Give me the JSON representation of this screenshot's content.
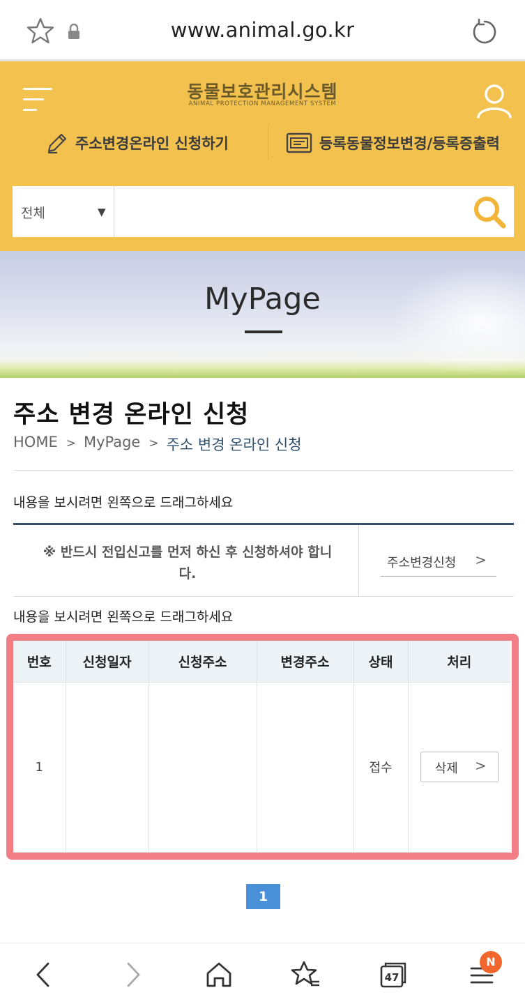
{
  "browser": {
    "url": "www.animal.go.kr",
    "tabs_count": "47",
    "menu_badge": "N"
  },
  "header": {
    "logo_main": "동물보호관리시스템",
    "logo_sub": "ANIMAL PROTECTION MANAGEMENT SYSTEM",
    "quick_links": [
      {
        "label": "주소변경온라인 신청하기",
        "icon": "pencil-icon"
      },
      {
        "label": "등록동물정보변경/등록증출력",
        "icon": "id-card-icon"
      }
    ],
    "search": {
      "category": "전체",
      "placeholder": ""
    }
  },
  "banner": {
    "title": "MyPage"
  },
  "page": {
    "title": "주소 변경 온라인 신청",
    "breadcrumb": [
      {
        "label": "HOME"
      },
      {
        "sep": ">",
        "label": "MyPage"
      },
      {
        "sep": ">",
        "label": "주소 변경 온라인 신청"
      }
    ],
    "drag_hint_1": "내용을 보시려면 왼쪽으로 드래그하세요",
    "notice_text": "※ 반드시 전입신고를 먼저 하신 후 신청하셔야 합니다.",
    "apply_button": "주소변경신청",
    "drag_hint_2": "내용을 보시려면 왼쪽으로 드래그하세요"
  },
  "table": {
    "headers": [
      "번호",
      "신청일자",
      "신청주소",
      "변경주소",
      "상태",
      "처리"
    ],
    "rows": [
      {
        "no": "1",
        "date": "",
        "from": "",
        "to": "",
        "status": "접수",
        "action": "삭제"
      }
    ]
  },
  "pagination": {
    "current": "1"
  },
  "colors": {
    "brand_yellow": "#f2c14e",
    "accent_navy": "#364f6b",
    "pager_blue": "#4a90d9",
    "highlight_red": "#f27d84"
  }
}
